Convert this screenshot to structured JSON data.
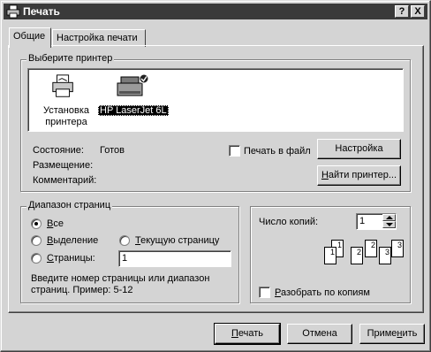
{
  "window": {
    "title": "Печать",
    "help_button": "?",
    "close_button": "X"
  },
  "tabs": [
    {
      "label": "Общие"
    },
    {
      "label": "Настройка печати"
    }
  ],
  "printer_group": {
    "legend": "Выберите принтер",
    "printers": [
      {
        "label_line1": "Установка",
        "label_line2": "принтера"
      },
      {
        "label": "HP LaserJet 6L"
      }
    ],
    "status_label": "Состояние:",
    "status_value": "Готов",
    "location_label": "Размещение:",
    "comment_label": "Комментарий:",
    "print_to_file": "Печать в файл",
    "settings_button": "Настройка",
    "find_printer_first": "Н",
    "find_printer_rest": "айти принтер..."
  },
  "range_group": {
    "legend": "Диапазон страниц",
    "all_ul": "В",
    "all_rest": "се",
    "selection_ul": "В",
    "selection_rest": "ыделение",
    "current_ul": "Т",
    "current_rest": "екущую страницу",
    "pages_ul": "С",
    "pages_rest": "траницы:",
    "pages_value": "1",
    "hint_line1": "Введите номер страницы или диапазон",
    "hint_line2": "страниц.  Пример: 5-12"
  },
  "copies_group": {
    "copies_label": "Число копий:",
    "copies_value": "1",
    "collate_ul": "Р",
    "collate_rest": "азобрать по копиям",
    "collate_pages": [
      "1",
      "1",
      "2",
      "2",
      "3",
      "3"
    ]
  },
  "footer": {
    "print_ul": "П",
    "print_rest": "ечать",
    "cancel": "Отмена",
    "apply_pre": "Приме",
    "apply_ul": "н",
    "apply_post": "ить"
  }
}
